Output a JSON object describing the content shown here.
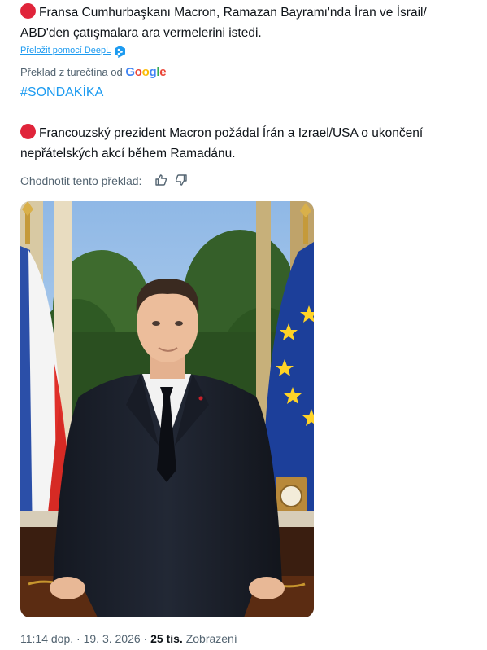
{
  "original": {
    "text_line1": "Fransa Cumhurbaşkanı Macron, Ramazan Bayramı'nda İran ve İsrail/",
    "text_line2": "ABD'den çatışmalara ara vermelerini istedi."
  },
  "deepl": {
    "label": "Přeložit pomocí DeepL",
    "icon": "deepl-icon"
  },
  "google": {
    "prefix": "Překlad z turečtina od",
    "logo_text": "Google"
  },
  "hashtag": "#SONDAKİKA",
  "translation": {
    "text_line1": "Francouzský prezident Macron požádal Írán a Izrael/USA o ukončení",
    "text_line2": "nepřátelských akcí během Ramadánu."
  },
  "rating": {
    "label": "Ohodnotit tento překlad:",
    "up_icon": "thumb-up-icon",
    "down_icon": "thumb-down-icon"
  },
  "meta": {
    "time": "11:14 dop.",
    "sep": " · ",
    "date": "19. 3. 2026",
    "views_count": "25 tis.",
    "views_label": "Zobrazení"
  },
  "colors": {
    "accent": "#1d9bf0",
    "red_dot": "#e0243a",
    "muted": "#536471"
  }
}
